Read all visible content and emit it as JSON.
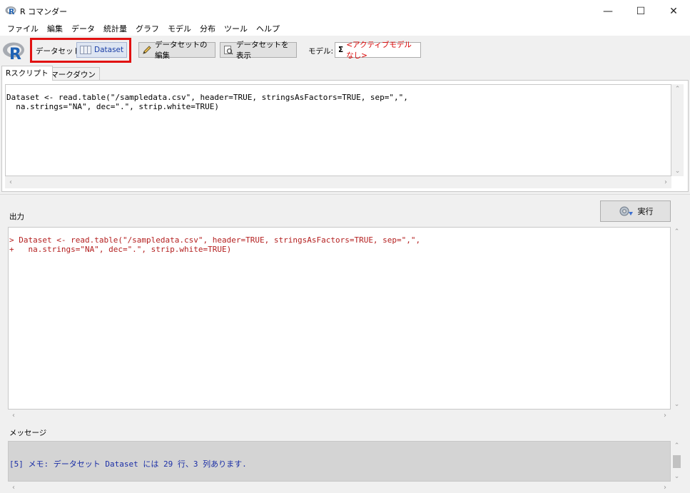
{
  "window": {
    "title": "R コマンダー",
    "minimize": "—",
    "maximize": "☐",
    "close": "✕"
  },
  "menu": [
    "ファイル",
    "編集",
    "データ",
    "統計量",
    "グラフ",
    "モデル",
    "分布",
    "ツール",
    "ヘルプ"
  ],
  "toolbar": {
    "dataset_label": "データセット:",
    "dataset_value": "Dataset",
    "edit_dataset": "データセットの編集",
    "view_dataset": "データセットを表示",
    "model_label": "モデル:",
    "model_sigma": "Σ",
    "model_value": "<アクティブモデルなし>"
  },
  "tabs": {
    "script": "Rスクリプト",
    "markdown": "Rマークダウン"
  },
  "script": {
    "lines": [
      "Dataset <- read.table(\"/sampledata.csv\", header=TRUE, stringsAsFactors=TRUE, sep=\",\",",
      "  na.strings=\"NA\", dec=\".\", strip.white=TRUE)"
    ]
  },
  "output": {
    "label": "出力",
    "run_button": "実行",
    "lines": [
      "> Dataset <- read.table(\"/sampledata.csv\", header=TRUE, stringsAsFactors=TRUE, sep=\",\",",
      "+   na.strings=\"NA\", dec=\".\", strip.white=TRUE)"
    ]
  },
  "messages": {
    "label": "メッセージ",
    "lines": [
      "[5] メモ: データセット Dataset には 29 行、3 列あります."
    ]
  },
  "colors": {
    "highlight": "#e11111",
    "output_text": "#b42020",
    "message_text": "#1a2ea6",
    "model_text": "#d80000"
  }
}
